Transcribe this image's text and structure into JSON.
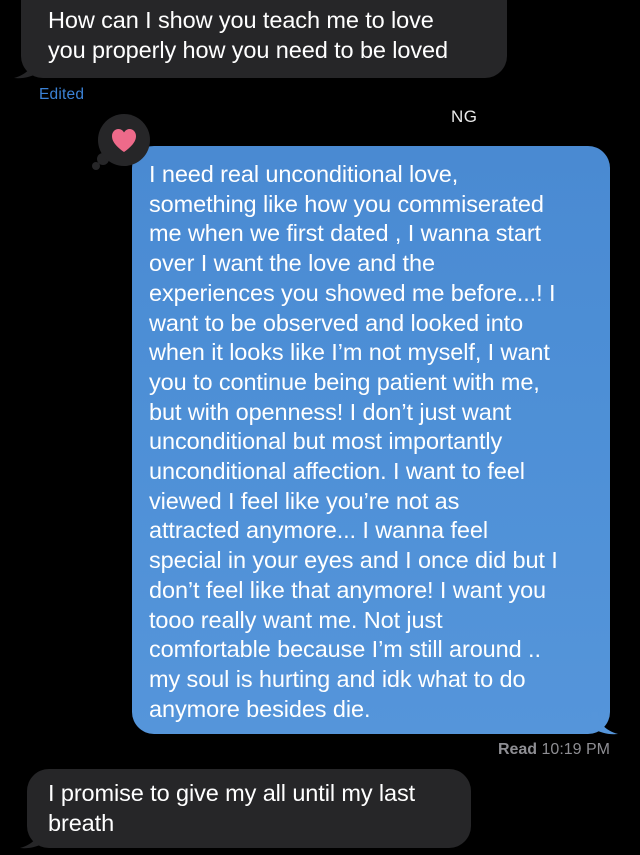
{
  "conversation": {
    "messages": [
      {
        "direction": "incoming",
        "lines": [
          "How can I show you teach me to love",
          "you properly how you need to be loved"
        ],
        "edited_label": "Edited"
      },
      {
        "direction": "outgoing",
        "sender": "NG",
        "reaction": "heart-icon",
        "lines": [
          "I need real unconditional love,",
          "something like how you commiserated",
          "me when we first dated , I wanna start",
          "over I want the love and the",
          "experiences you showed me before...! I",
          "want to be observed and looked into",
          "when it looks like I’m not myself, I want",
          "you to continue being patient with me,",
          "but with openness! I don’t just want",
          "unconditional but most importantly",
          "unconditional affection. I want to feel",
          "viewed I feel like you’re not as",
          "attracted anymore... I wanna feel",
          "special in your eyes and I once did but I",
          "don’t feel like that anymore! I want you",
          "tooo really want me. Not just",
          "comfortable because I’m still around ..",
          "my soul is hurting and idk what to do",
          "anymore besides die."
        ],
        "receipt": {
          "status": "Read",
          "time": "10:19 PM"
        }
      },
      {
        "direction": "incoming",
        "lines": [
          "I promise to give my all until my last",
          "breath"
        ]
      }
    ]
  },
  "colors": {
    "background": "#000000",
    "incoming_bubble": "#262628",
    "outgoing_bubble": "#4d8fd6",
    "edited_label": "#3b82d6",
    "heart": "#ee6a8a",
    "meta_text": "#8e8e93"
  }
}
